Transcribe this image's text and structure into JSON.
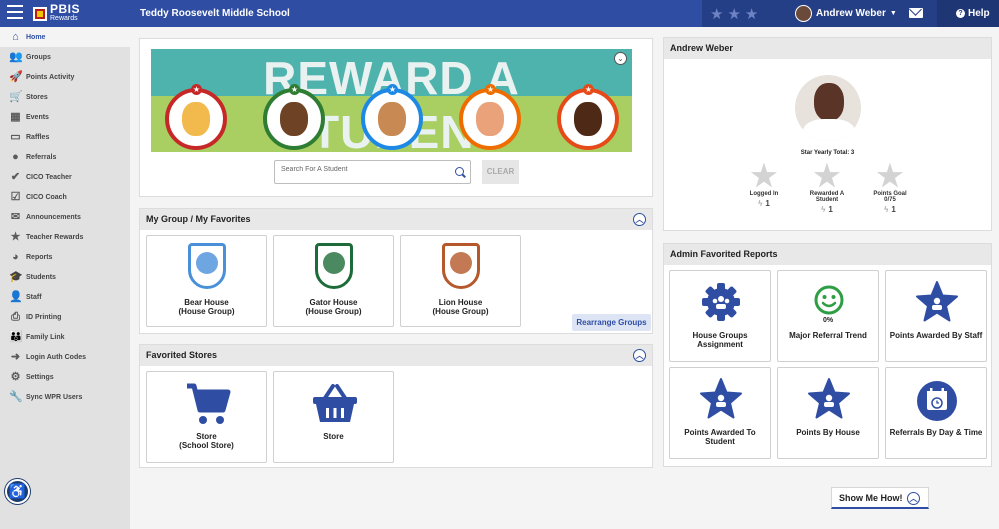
{
  "header": {
    "logo_main": "PBIS",
    "logo_sub": "Rewards",
    "school": "Teddy Roosevelt Middle School",
    "user_name": "Andrew Weber",
    "help_label": "Help",
    "star_glyph": "★★★"
  },
  "sidebar": {
    "items": [
      {
        "label": "Home",
        "icon": "house-icon",
        "glyph": "⌂"
      },
      {
        "label": "Groups",
        "icon": "people-icon",
        "glyph": "👥"
      },
      {
        "label": "Points Activity",
        "icon": "rocket-icon",
        "glyph": "🚀"
      },
      {
        "label": "Stores",
        "icon": "cart-icon",
        "glyph": "🛒"
      },
      {
        "label": "Events",
        "icon": "calendar-icon",
        "glyph": "▦"
      },
      {
        "label": "Raffles",
        "icon": "ticket-icon",
        "glyph": "▭"
      },
      {
        "label": "Referrals",
        "icon": "alert-icon",
        "glyph": "●"
      },
      {
        "label": "CICO Teacher",
        "icon": "check-circle-icon",
        "glyph": "✔"
      },
      {
        "label": "CICO Coach",
        "icon": "clipboard-check-icon",
        "glyph": "☑"
      },
      {
        "label": "Announcements",
        "icon": "envelope-icon",
        "glyph": "✉"
      },
      {
        "label": "Teacher Rewards",
        "icon": "star-icon",
        "glyph": "★"
      },
      {
        "label": "Reports",
        "icon": "pie-chart-icon",
        "glyph": "◕"
      },
      {
        "label": "Students",
        "icon": "graduation-cap-icon",
        "glyph": "🎓"
      },
      {
        "label": "Staff",
        "icon": "person-icon",
        "glyph": "👤"
      },
      {
        "label": "ID Printing",
        "icon": "printer-icon",
        "glyph": "⎙"
      },
      {
        "label": "Family Link",
        "icon": "family-icon",
        "glyph": "👪"
      },
      {
        "label": "Login Auth Codes",
        "icon": "login-icon",
        "glyph": "➜"
      },
      {
        "label": "Settings",
        "icon": "gear-icon",
        "glyph": "⚙"
      },
      {
        "label": "Sync WPR Users",
        "icon": "wrench-icon",
        "glyph": "🔧"
      }
    ]
  },
  "reward": {
    "banner_text": "REWARD A STUDENT",
    "search_placeholder": "Search For A Student",
    "clear_label": "CLEAR"
  },
  "groups": {
    "title": "My Group / My Favorites",
    "cards": [
      {
        "name": "Bear House",
        "type": "(House Group)",
        "color": "#4a90d9"
      },
      {
        "name": "Gator House",
        "type": "(House Group)",
        "color": "#1e6b3a"
      },
      {
        "name": "Lion House",
        "type": "(House Group)",
        "color": "#b5582b"
      }
    ],
    "rearrange_label": "Rearrange Groups"
  },
  "stores": {
    "title": "Favorited Stores",
    "cards": [
      {
        "name": "Store",
        "sub": "(School Store)"
      },
      {
        "name": "Store",
        "sub": ""
      }
    ]
  },
  "profile": {
    "title": "Andrew Weber",
    "star_total": "Star Yearly Total: 3",
    "stats": [
      {
        "label": "Logged In",
        "label2": "",
        "count": "1"
      },
      {
        "label": "Rewarded A",
        "label2": "Student",
        "count": "1"
      },
      {
        "label": "Points Goal",
        "label2": "0/75",
        "count": "1"
      }
    ]
  },
  "reports": {
    "title": "Admin Favorited Reports",
    "cards": [
      {
        "label": "House Groups",
        "label2": "Assignment",
        "value": ""
      },
      {
        "label": "Major Referral Trend",
        "label2": "",
        "value": "0%"
      },
      {
        "label": "Points Awarded By Staff",
        "label2": "",
        "value": ""
      },
      {
        "label": "Points Awarded To",
        "label2": "Student",
        "value": ""
      },
      {
        "label": "Points By House",
        "label2": "",
        "value": ""
      },
      {
        "label": "Referrals By Day & Time",
        "label2": "",
        "value": ""
      }
    ]
  },
  "showme": {
    "label": "Show Me How!"
  },
  "colors": {
    "brand": "#2f4ea3",
    "brand_dark": "#253f86",
    "success": "#2e9e44"
  }
}
